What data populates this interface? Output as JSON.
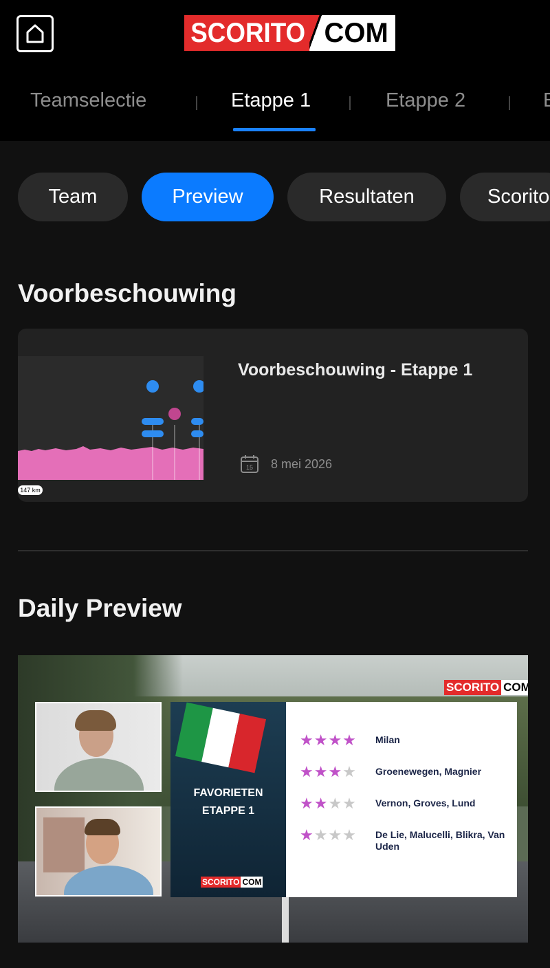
{
  "header": {
    "logo_left": "SCORITO",
    "logo_right": "COM",
    "stage_tabs": [
      {
        "label": "Teamselectie",
        "active": false
      },
      {
        "label": "Etappe 1",
        "active": true
      },
      {
        "label": "Etappe 2",
        "active": false
      },
      {
        "label": "E",
        "active": false
      }
    ]
  },
  "subtabs": [
    {
      "label": "Team",
      "active": false
    },
    {
      "label": "Preview",
      "active": true
    },
    {
      "label": "Resultaten",
      "active": false
    },
    {
      "label": "Scorito",
      "active": false
    }
  ],
  "preview_section": {
    "title": "Voorbeschouwing",
    "card": {
      "title": "Voorbeschouwing - Etappe 1",
      "date": "8 mei 2026",
      "calendar_day": "15",
      "thumb_badge": "147 km"
    }
  },
  "daily_section": {
    "title": "Daily Preview",
    "video": {
      "logo_left": "SCORITO",
      "logo_right": "COM",
      "panel_line1": "FAVORIETEN",
      "panel_line2": "ETAPPE 1",
      "ratings": [
        {
          "stars": 4,
          "names": "Milan"
        },
        {
          "stars": 3,
          "names": "Groenewegen, Magnier"
        },
        {
          "stars": 2,
          "names": "Vernon, Groves, Lund"
        },
        {
          "stars": 1,
          "names": "De Lie, Malucelli, Blikra, Van Uden"
        }
      ]
    }
  },
  "colors": {
    "accent": "#0b7bff",
    "brand_red": "#e32b2b",
    "background": "#111111",
    "card": "#222222",
    "star_on": "#c052c8"
  }
}
